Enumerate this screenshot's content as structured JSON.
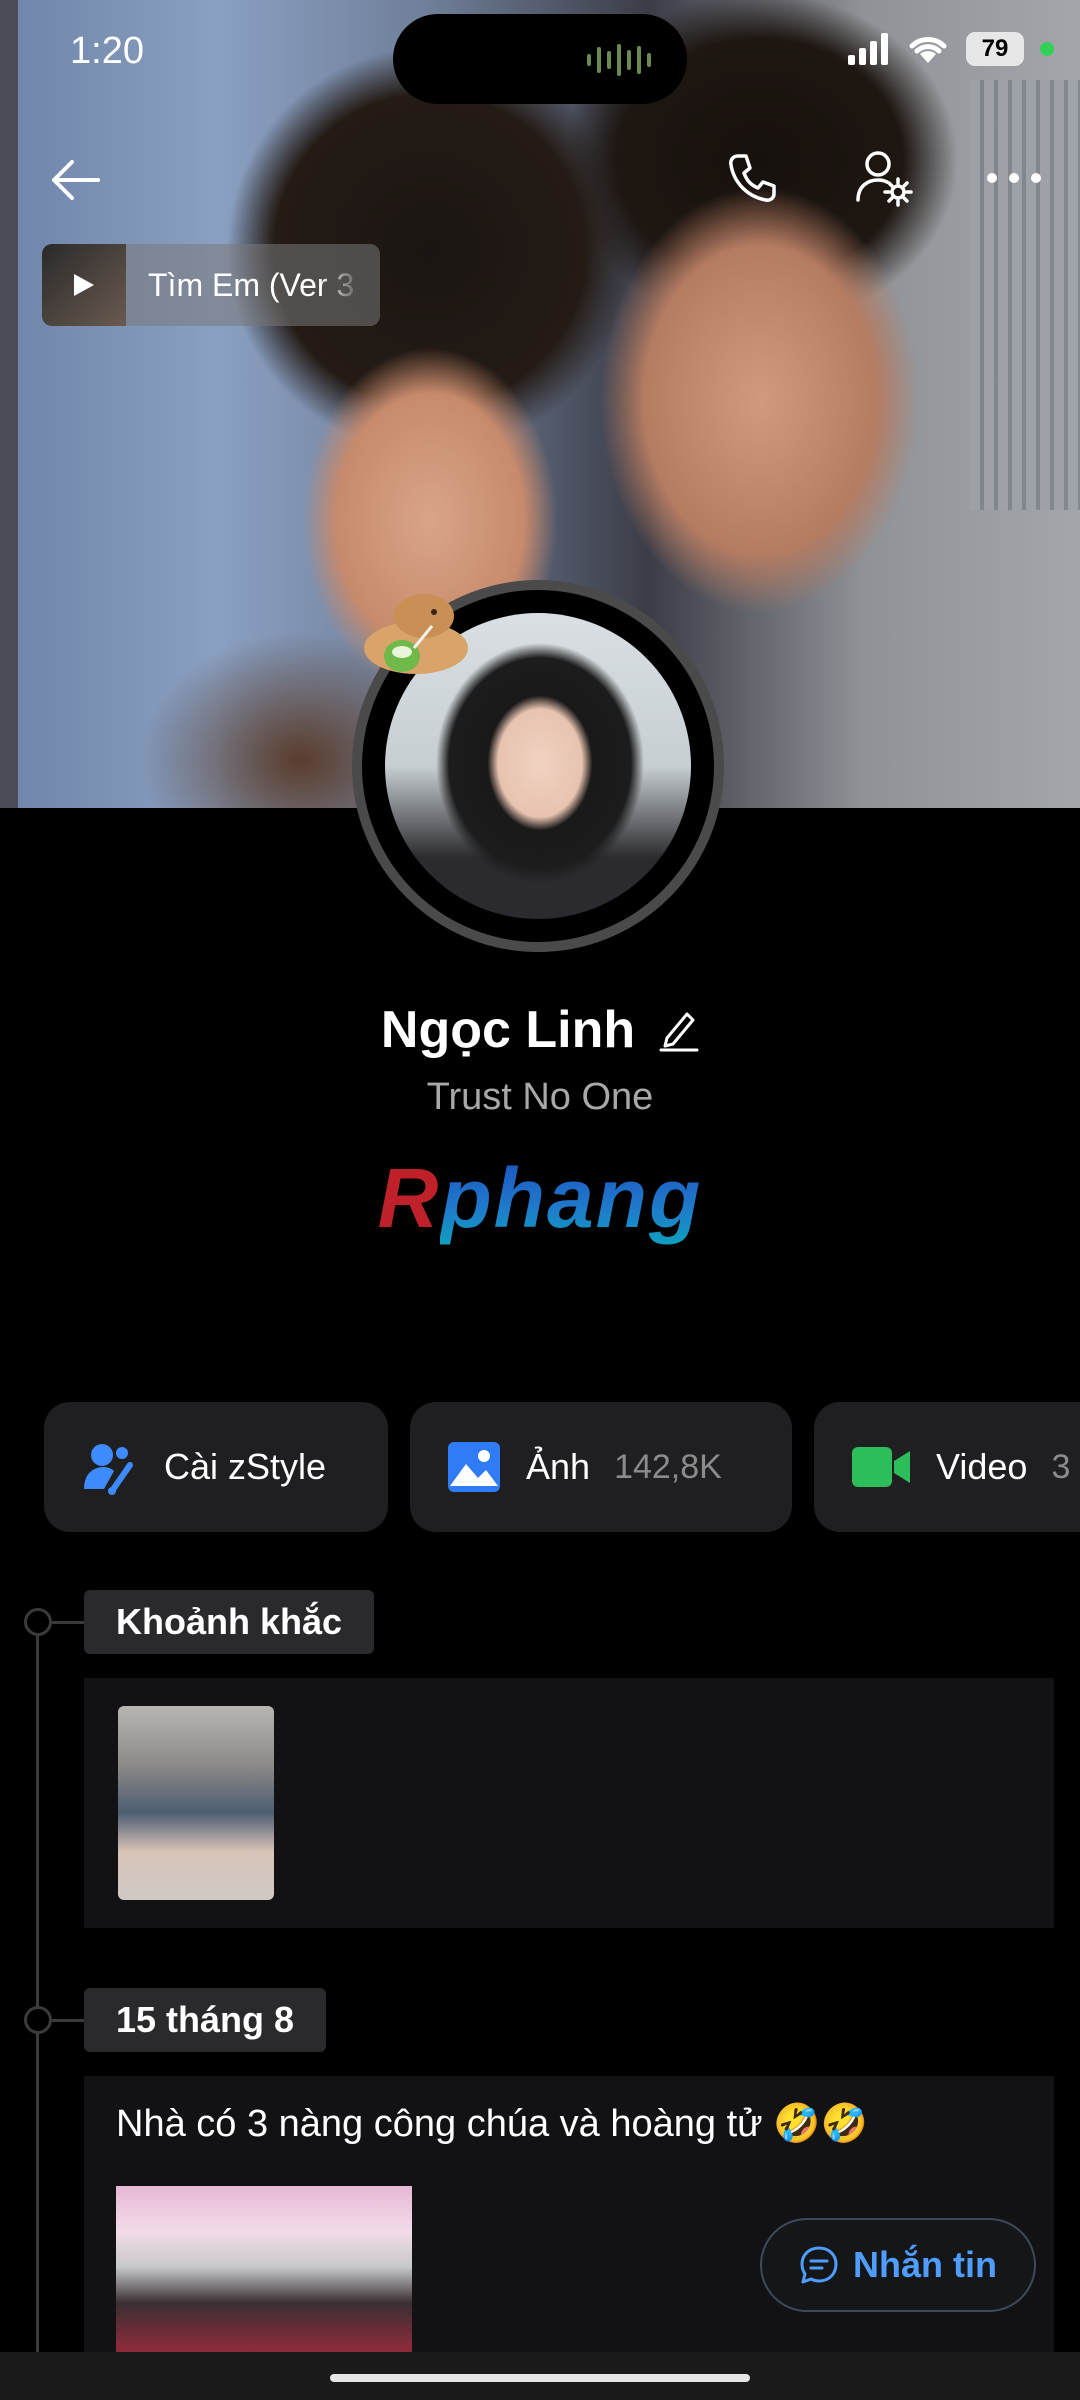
{
  "status_bar": {
    "time": "1:20",
    "battery": "79"
  },
  "toolbar": {
    "back_icon": "arrow-left-icon",
    "call_icon": "phone-icon",
    "profile_settings_icon": "user-gear-icon",
    "more_icon": "more-horizontal-icon"
  },
  "music": {
    "title": "Tìm Em (Ver 3"
  },
  "profile": {
    "name": "Ngọc Linh",
    "status": "Trust No One",
    "brand_r": "R",
    "brand_rest": "phang"
  },
  "chips": [
    {
      "label": "Cài zStyle",
      "count": "",
      "icon": "zstyle-icon",
      "color": "#3d8bff"
    },
    {
      "label": "Ảnh",
      "count": "142,8K",
      "icon": "image-icon",
      "color": "#2f7cf6"
    },
    {
      "label": "Video",
      "count": "3",
      "icon": "video-icon",
      "color": "#2dbd5a"
    }
  ],
  "timeline": {
    "moments_label": "Khoảnh khắc",
    "date_label": "15 tháng 8",
    "post_text": "Nhà có 3 nàng công chúa và hoàng tử 🤣🤣"
  },
  "message_button": {
    "label": "Nhắn tin"
  }
}
